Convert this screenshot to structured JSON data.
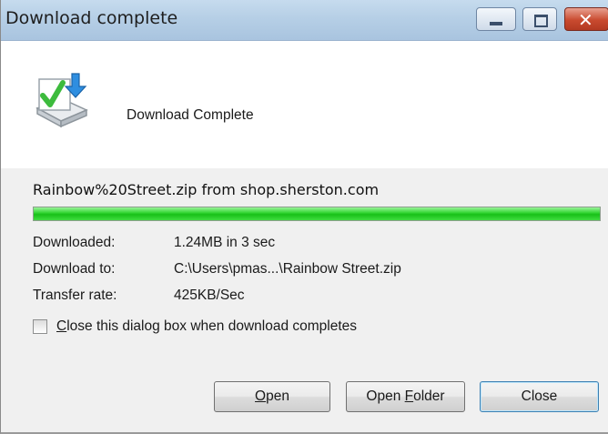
{
  "window": {
    "title": "Download complete",
    "controls": {
      "minimize": "minimize-icon",
      "maximize": "maximize-icon",
      "close": "close-icon"
    }
  },
  "header": {
    "icon": "download-complete-icon",
    "heading": "Download Complete"
  },
  "download": {
    "source": "Rainbow%20Street.zip from shop.sherston.com",
    "progress_fraction": 1.0,
    "progress_color": "#1ec71e"
  },
  "details": [
    {
      "label": "Downloaded:",
      "value": "1.24MB in 3 sec"
    },
    {
      "label": "Download to:",
      "value": "C:\\Users\\pmas...\\Rainbow Street.zip"
    },
    {
      "label": "Transfer rate:",
      "value": "425KB/Sec"
    }
  ],
  "option": {
    "checked": false,
    "label_accel": "C",
    "label_rest": "lose this dialog box when download completes"
  },
  "buttons": {
    "open": {
      "accel": "O",
      "rest": "pen"
    },
    "open_folder": {
      "prefix": "Open ",
      "accel": "F",
      "rest": "older"
    },
    "close": {
      "label": "Close"
    }
  }
}
